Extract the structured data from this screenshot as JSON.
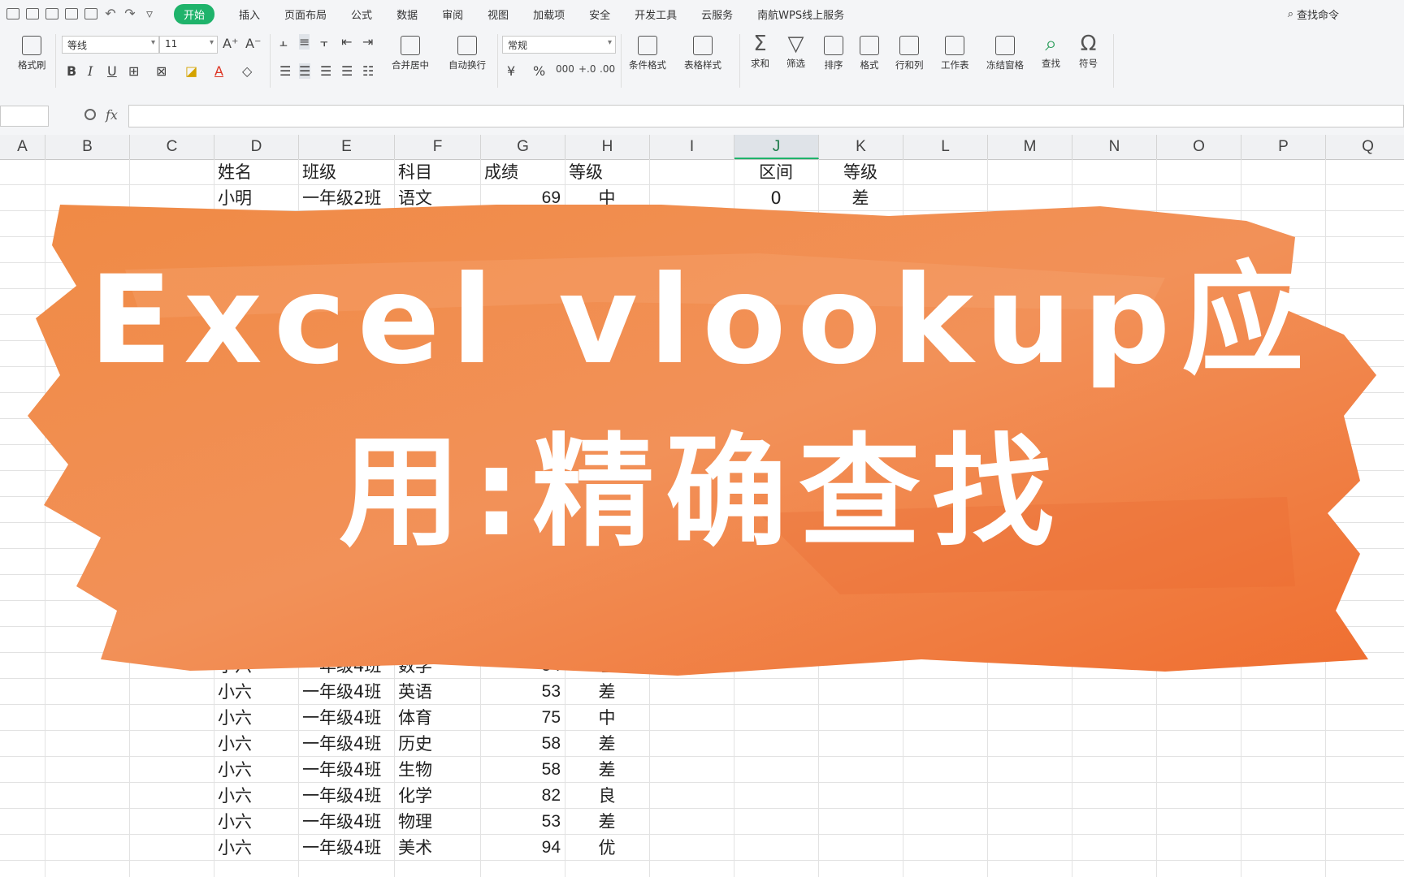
{
  "menu": {
    "items": [
      "开始",
      "插入",
      "页面布局",
      "公式",
      "数据",
      "审阅",
      "视图",
      "加载项",
      "安全",
      "开发工具",
      "云服务",
      "南航WPS线上服务"
    ],
    "active_index": 0,
    "search_label": "查找命令"
  },
  "ribbon": {
    "format_brush": "格式刷",
    "font_name": "等线",
    "font_size": "11",
    "merge_center": "合并居中",
    "wrap_text": "自动换行",
    "number_format": "常规",
    "conditional_format": "条件格式",
    "table_style": "表格样式",
    "sum": "求和",
    "filter": "筛选",
    "sort": "排序",
    "format": "格式",
    "row_col": "行和列",
    "worksheet": "工作表",
    "freeze": "冻结窗格",
    "find": "查找",
    "symbol": "符号"
  },
  "formula_bar": {
    "fx_label": "fx"
  },
  "columns": [
    "A",
    "B",
    "C",
    "D",
    "E",
    "F",
    "G",
    "H",
    "I",
    "J",
    "K",
    "L",
    "M",
    "N",
    "O",
    "P",
    "Q"
  ],
  "selected_column": "J",
  "table": {
    "headers": [
      "姓名",
      "班级",
      "科目",
      "成绩",
      "等级"
    ],
    "rows_top": [
      [
        "小明",
        "一年级2班",
        "语文",
        "69",
        "中"
      ]
    ],
    "rows_bottom": [
      [
        "小六",
        "一年级4班",
        "数学",
        "54",
        "差"
      ],
      [
        "小六",
        "一年级4班",
        "英语",
        "53",
        "差"
      ],
      [
        "小六",
        "一年级4班",
        "体育",
        "75",
        "中"
      ],
      [
        "小六",
        "一年级4班",
        "历史",
        "58",
        "差"
      ],
      [
        "小六",
        "一年级4班",
        "生物",
        "58",
        "差"
      ],
      [
        "小六",
        "一年级4班",
        "化学",
        "82",
        "良"
      ],
      [
        "小六",
        "一年级4班",
        "物理",
        "53",
        "差"
      ],
      [
        "小六",
        "一年级4班",
        "美术",
        "94",
        "优"
      ]
    ]
  },
  "lookup_table": {
    "headers": [
      "区间",
      "等级"
    ],
    "rows": [
      [
        "0",
        "差"
      ]
    ]
  },
  "banner": {
    "line1": "Excel vlookup应",
    "line2": "用:精确查找",
    "color": "#f07a3a"
  }
}
